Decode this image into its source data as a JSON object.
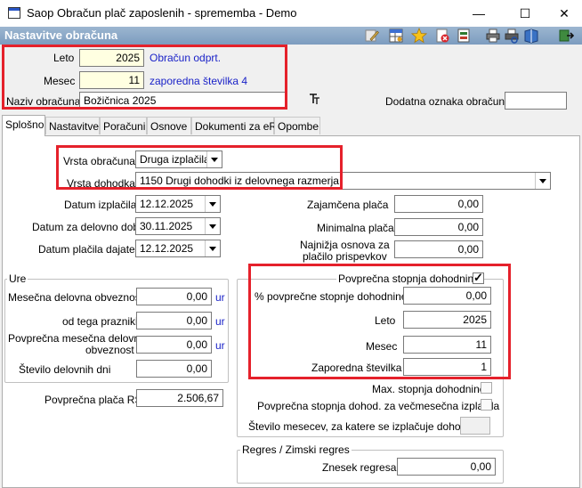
{
  "window": {
    "title": "Saop Obračun plač zaposlenih - sprememba - Demo",
    "minimize": "—",
    "maximize": "☐",
    "close": "✕"
  },
  "header": {
    "title": "Nastavitve obračuna"
  },
  "top": {
    "leto_label": "Leto",
    "leto_value": "2025",
    "status": "Obračun odprt.",
    "mesec_label": "Mesec",
    "mesec_value": "11",
    "zaporedna": "zaporedna številka 4",
    "naziv_label": "Naziv obračuna",
    "naziv_value": "Božičnica 2025",
    "dodatna_label": "Dodatna oznaka obračuna",
    "dodatna_value": ""
  },
  "tabs": [
    {
      "label": "Splošno"
    },
    {
      "label": "Nastavitve"
    },
    {
      "label": "Poračuni"
    },
    {
      "label": "Osnove"
    },
    {
      "label": "Dokumenti za eR"
    },
    {
      "label": "Opombe"
    }
  ],
  "general": {
    "vrsta_obracuna_label": "Vrsta obračuna",
    "vrsta_obracuna_value": "Druga izplačila",
    "vrsta_dohodka_label": "Vrsta dohodka",
    "vrsta_dohodka_value": "1150  Drugi dohodki iz delovnega razmerja",
    "datum_izplacila_label": "Datum izplačila",
    "datum_izplacila_value": "12.12.2025",
    "datum_delovno_label": "Datum za delovno dobo",
    "datum_delovno_value": "30.11.2025",
    "datum_placila_label": "Datum plačila dajatev",
    "datum_placila_value": "12.12.2025",
    "zajamcena_label": "Zajamčena plača",
    "zajamcena_value": "0,00",
    "minimalna_label": "Minimalna plača",
    "minimalna_value": "0,00",
    "najnizja_label1": "Najnižja osnova za",
    "najnizja_label2": "plačilo prispevkov",
    "najnizja_value": "0,00"
  },
  "ure": {
    "title": "Ure",
    "mesecna_label": "Mesečna delovna obveznost",
    "mesecna_value": "0,00",
    "prazniki_label": "od tega prazniki",
    "prazniki_value": "0,00",
    "povp_label1": "Povprečna mesečna delovna",
    "povp_label2": "obveznost",
    "povp_value": "0,00",
    "dnevi_label": "Število delovnih dni",
    "dnevi_value": "0,00",
    "unit": "ur"
  },
  "povprecna_placa": {
    "label": "Povprečna plača RS",
    "value": "2.506,67"
  },
  "dohodnina": {
    "title": "Povprečna stopnja dohodnine",
    "pct_label": "% povprečne stopnje dohodnine",
    "pct_value": "0,00",
    "leto_label": "Leto",
    "leto_value": "2025",
    "mesec_label": "Mesec",
    "mesec_value": "11",
    "zap_label": "Zaporedna številka",
    "zap_value": "1",
    "max_label": "Max. stopnja dohodnine",
    "vecmesecna_label": "Povprečna stopnja dohod. za večmesečna izplačila",
    "stevilo_label": "Število mesecev, za katere se izplačuje dohodek",
    "stevilo_value": ""
  },
  "regres": {
    "title": "Regres / Zimski regres",
    "znesek_label": "Znesek regresa",
    "znesek_value": "0,00"
  },
  "colors": {
    "red_highlight": "#e5212b",
    "accent_blue": "#1a22c8",
    "yellow_field": "#ffffe1"
  }
}
